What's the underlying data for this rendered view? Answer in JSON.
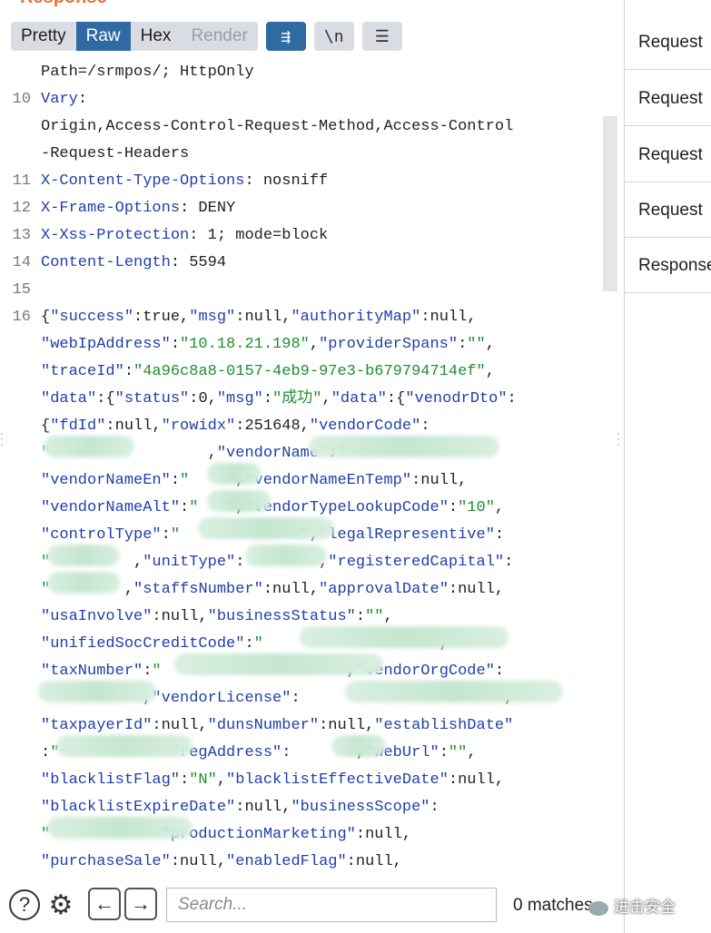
{
  "panel": {
    "title": "Response"
  },
  "toolbar": {
    "tabs": [
      {
        "label": "Pretty"
      },
      {
        "label": "Raw"
      },
      {
        "label": "Hex"
      },
      {
        "label": "Render"
      }
    ],
    "wrap_glyph": "⇶",
    "newline_label": "\\n",
    "menu_glyph": "☰"
  },
  "lines": [
    {
      "num": "",
      "text": "Path=/srmpos/; HttpOnly"
    },
    {
      "num": "10",
      "key": "Vary",
      "text": ":"
    },
    {
      "num": "",
      "text": "Origin,Access-Control-Request-Method,Access-Control"
    },
    {
      "num": "",
      "text": "-Request-Headers"
    },
    {
      "num": "11",
      "key": "X-Content-Type-Options",
      "text": ": nosniff"
    },
    {
      "num": "12",
      "key": "X-Frame-Options",
      "text": ": DENY"
    },
    {
      "num": "13",
      "key": "X-Xss-Protection",
      "text": ": 1; mode=block"
    },
    {
      "num": "14",
      "key": "Content-Length",
      "text": ": 5594"
    },
    {
      "num": "15",
      "text": ""
    },
    {
      "num": "16",
      "json": [
        [
          "p",
          "{"
        ],
        [
          "k",
          "\"success\""
        ],
        [
          "p",
          ":true,"
        ],
        [
          "k",
          "\"msg\""
        ],
        [
          "p",
          ":null,"
        ],
        [
          "k",
          "\"authorityMap\""
        ],
        [
          "p",
          ":null,"
        ]
      ]
    },
    {
      "num": "",
      "json": [
        [
          "k",
          "\"webIpAddress\""
        ],
        [
          "p",
          ":"
        ],
        [
          "v",
          "\"10.18.21.198\""
        ],
        [
          "p",
          ","
        ],
        [
          "k",
          "\"providerSpans\""
        ],
        [
          "p",
          ":"
        ],
        [
          "v",
          "\"\""
        ],
        [
          "p",
          ","
        ]
      ]
    },
    {
      "num": "",
      "json": [
        [
          "k",
          "\"traceId\""
        ],
        [
          "p",
          ":"
        ],
        [
          "v",
          "\"4a96c8a8-0157-4eb9-97e3-b679794714ef\""
        ],
        [
          "p",
          ","
        ]
      ]
    },
    {
      "num": "",
      "json": [
        [
          "k",
          "\"data\""
        ],
        [
          "p",
          ":{"
        ],
        [
          "k",
          "\"status\""
        ],
        [
          "p",
          ":0,"
        ],
        [
          "k",
          "\"msg\""
        ],
        [
          "p",
          ":"
        ],
        [
          "v",
          "\"成功\""
        ],
        [
          "p",
          ","
        ],
        [
          "k",
          "\"data\""
        ],
        [
          "p",
          ":{"
        ],
        [
          "k",
          "\"venodrDto\""
        ],
        [
          "p",
          ":"
        ]
      ]
    },
    {
      "num": "",
      "json": [
        [
          "p",
          "{"
        ],
        [
          "k",
          "\"fdId\""
        ],
        [
          "p",
          ":null,"
        ],
        [
          "k",
          "\"rowidx\""
        ],
        [
          "p",
          ":251648,"
        ],
        [
          "k",
          "\"vendorCode\""
        ],
        [
          "p",
          ":"
        ]
      ]
    },
    {
      "num": "",
      "json": [
        [
          "v",
          "\""
        ],
        [
          "p",
          "                 ,"
        ],
        [
          "k",
          "\"vendorName\""
        ],
        [
          "p",
          ":"
        ],
        [
          "v",
          "\""
        ]
      ]
    },
    {
      "num": "",
      "json": [
        [
          "k",
          "\"vendorNameEn\""
        ],
        [
          "p",
          ":"
        ],
        [
          "v",
          "\"    \""
        ],
        [
          "p",
          ","
        ],
        [
          "k",
          "\"vendorNameEnTemp\""
        ],
        [
          "p",
          ":null,"
        ]
      ]
    },
    {
      "num": "",
      "json": [
        [
          "k",
          "\"vendorNameAlt\""
        ],
        [
          "p",
          ":"
        ],
        [
          "v",
          "\"   \""
        ],
        [
          "p",
          ","
        ],
        [
          "k",
          "\"vendorTypeLookupCode\""
        ],
        [
          "p",
          ":"
        ],
        [
          "v",
          "\"10\""
        ],
        [
          "p",
          ","
        ]
      ]
    },
    {
      "num": "",
      "json": [
        [
          "k",
          "\"controlType\""
        ],
        [
          "p",
          ":"
        ],
        [
          "v",
          "\"             \""
        ],
        [
          "p",
          ","
        ],
        [
          "k",
          "\"legalRepresentive\""
        ],
        [
          "p",
          ":"
        ]
      ]
    },
    {
      "num": "",
      "json": [
        [
          "v",
          "\"         "
        ],
        [
          "p",
          ","
        ],
        [
          "k",
          "\"unitType\""
        ],
        [
          "p",
          ":        ,"
        ],
        [
          "k",
          "\"registeredCapital\""
        ],
        [
          "p",
          ":"
        ]
      ]
    },
    {
      "num": "",
      "json": [
        [
          "v",
          "\"        "
        ],
        [
          "p",
          ","
        ],
        [
          "k",
          "\"staffsNumber\""
        ],
        [
          "p",
          ":null,"
        ],
        [
          "k",
          "\"approvalDate\""
        ],
        [
          "p",
          ":null,"
        ]
      ]
    },
    {
      "num": "",
      "json": [
        [
          "k",
          "\"usaInvolve\""
        ],
        [
          "p",
          ":null,"
        ],
        [
          "k",
          "\"businessStatus\""
        ],
        [
          "p",
          ":"
        ],
        [
          "v",
          "\"\""
        ],
        [
          "p",
          ","
        ]
      ]
    },
    {
      "num": "",
      "json": [
        [
          "k",
          "\"unifiedSocCreditCode\""
        ],
        [
          "p",
          ":"
        ],
        [
          "v",
          "\""
        ],
        [
          "p",
          "                   ,"
        ]
      ]
    },
    {
      "num": "",
      "json": [
        [
          "k",
          "\"taxNumber\""
        ],
        [
          "p",
          ":"
        ],
        [
          "v",
          "\""
        ],
        [
          "p",
          "                    ,"
        ],
        [
          "k",
          "\"vendorOrgCode\""
        ],
        [
          "p",
          ":"
        ]
      ]
    },
    {
      "num": "",
      "json": [
        [
          "p",
          "           ,"
        ],
        [
          "k",
          "\"vendorLicense\""
        ],
        [
          "p",
          ":                      ,"
        ]
      ]
    },
    {
      "num": "",
      "json": [
        [
          "k",
          "\"taxpayerId\""
        ],
        [
          "p",
          ":null,"
        ],
        [
          "k",
          "\"dunsNumber\""
        ],
        [
          "p",
          ":null,"
        ],
        [
          "k",
          "\"establishDate\""
        ]
      ]
    },
    {
      "num": "",
      "json": [
        [
          "p",
          ":"
        ],
        [
          "v",
          "\""
        ],
        [
          "p",
          "            "
        ],
        [
          "k",
          "\"regAddress\""
        ],
        [
          "p",
          ":       ,"
        ],
        [
          "k",
          "\"webUrl\""
        ],
        [
          "p",
          ":"
        ],
        [
          "v",
          "\"\""
        ],
        [
          "p",
          ","
        ]
      ]
    },
    {
      "num": "",
      "json": [
        [
          "k",
          "\"blacklistFlag\""
        ],
        [
          "p",
          ":"
        ],
        [
          "v",
          "\"N\""
        ],
        [
          "p",
          ","
        ],
        [
          "k",
          "\"blacklistEffectiveDate\""
        ],
        [
          "p",
          ":null,"
        ]
      ]
    },
    {
      "num": "",
      "json": [
        [
          "k",
          "\"blacklistExpireDate\""
        ],
        [
          "p",
          ":null,"
        ],
        [
          "k",
          "\"businessScope\""
        ],
        [
          "p",
          ":"
        ]
      ]
    },
    {
      "num": "",
      "json": [
        [
          "v",
          "\""
        ],
        [
          "p",
          "            "
        ],
        [
          "k",
          "\"productionMarketing\""
        ],
        [
          "p",
          ":null,"
        ]
      ]
    },
    {
      "num": "",
      "json": [
        [
          "k",
          "\"purchaseSale\""
        ],
        [
          "p",
          ":null,"
        ],
        [
          "k",
          "\"enabledFlag\""
        ],
        [
          "p",
          ":null,"
        ]
      ]
    }
  ],
  "sidebar": {
    "items": [
      {
        "label": "Request"
      },
      {
        "label": "Request"
      },
      {
        "label": "Request"
      },
      {
        "label": "Request"
      },
      {
        "label": "Response"
      }
    ]
  },
  "bottom": {
    "search_placeholder": "Search...",
    "matches": "0 matches",
    "help_glyph": "?",
    "settings_glyph": "⚙",
    "prev_glyph": "←",
    "next_glyph": "→"
  },
  "watermark": {
    "text": "进击安全"
  }
}
